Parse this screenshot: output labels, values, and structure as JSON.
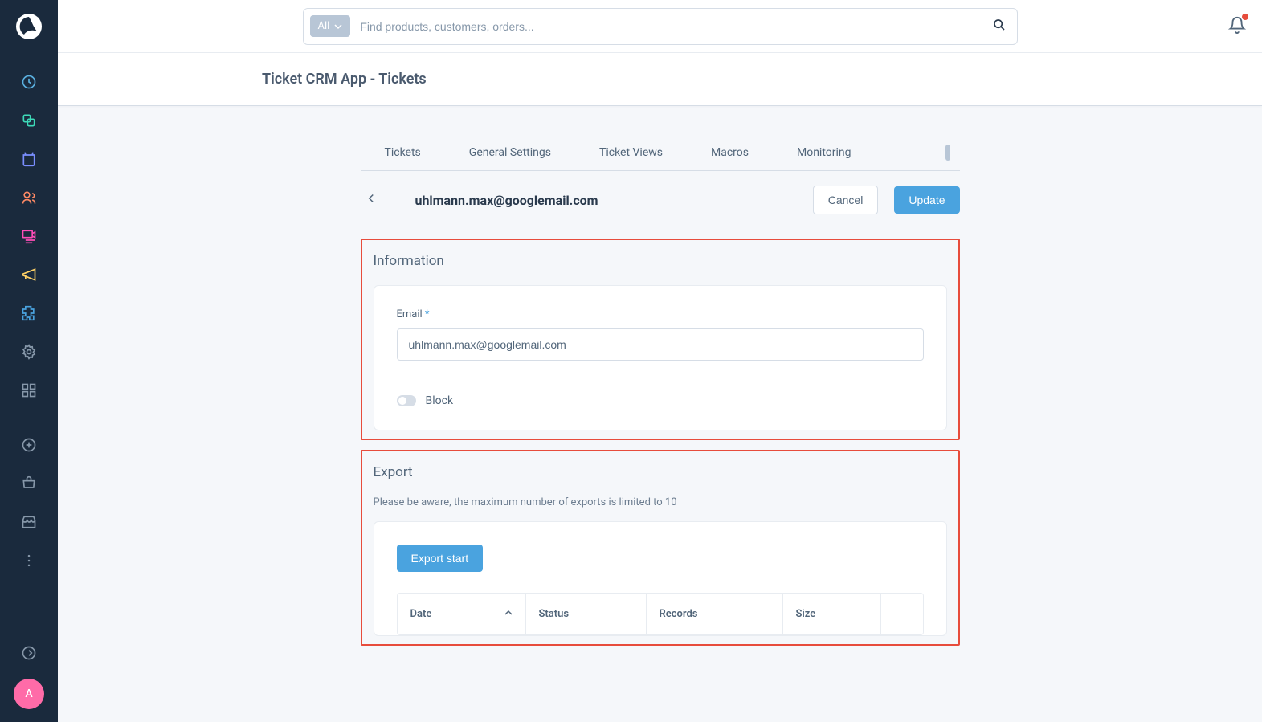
{
  "search": {
    "filter_label": "All",
    "placeholder": "Find products, customers, orders..."
  },
  "avatar_letter": "A",
  "page_title": "Ticket CRM App - Tickets",
  "tabs": [
    "Tickets",
    "General Settings",
    "Ticket Views",
    "Macros",
    "Monitoring"
  ],
  "detail": {
    "title": "uhlmann.max@googlemail.com",
    "cancel_label": "Cancel",
    "update_label": "Update"
  },
  "information": {
    "heading": "Information",
    "email_label": "Email",
    "email_value": "uhlmann.max@googlemail.com",
    "block_label": "Block",
    "block_on": false
  },
  "export": {
    "heading": "Export",
    "note": "Please be aware, the maximum number of exports is limited to 10",
    "start_label": "Export start",
    "columns": {
      "date": "Date",
      "status": "Status",
      "records": "Records",
      "size": "Size"
    }
  },
  "sidebar_icons": [
    "dashboard",
    "catalogues",
    "orders",
    "customers",
    "content",
    "marketing",
    "extensions",
    "settings",
    "apps",
    "plus",
    "cart",
    "store",
    "more",
    "help"
  ]
}
